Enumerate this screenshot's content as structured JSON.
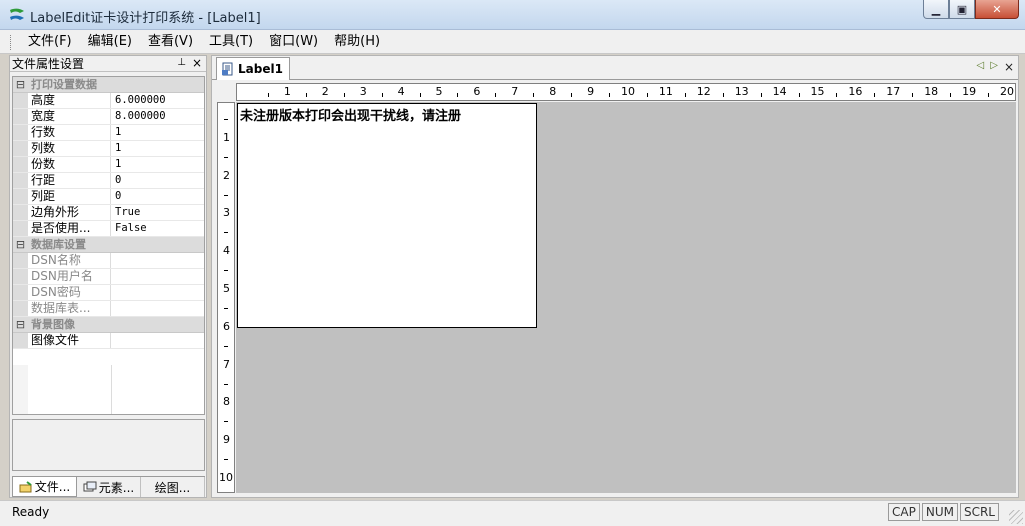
{
  "window": {
    "title": "LabelEdit证卡设计打印系统 - [Label1]",
    "minimize_glyph": "▁",
    "maximize_glyph": "▣",
    "close_glyph": "✕"
  },
  "menu": {
    "items": [
      "文件(F)",
      "编辑(E)",
      "查看(V)",
      "工具(T)",
      "窗口(W)",
      "帮助(H)"
    ]
  },
  "left_pane": {
    "title": "文件属性设置",
    "pin_glyph": "⊥",
    "close_glyph": "×",
    "categories": [
      {
        "name": "打印设置数据",
        "toggle": "⊟",
        "rows": [
          {
            "name": "高度",
            "value": "6.000000"
          },
          {
            "name": "宽度",
            "value": "8.000000"
          },
          {
            "name": "行数",
            "value": "1"
          },
          {
            "name": "列数",
            "value": "1"
          },
          {
            "name": "份数",
            "value": "1"
          },
          {
            "name": "行距",
            "value": "0"
          },
          {
            "name": "列距",
            "value": "0"
          },
          {
            "name": "边角外形",
            "value": "True"
          },
          {
            "name": "是否使用...",
            "value": "False"
          }
        ]
      },
      {
        "name": "数据库设置",
        "toggle": "⊟",
        "rows": [
          {
            "name": "DSN名称",
            "value": ""
          },
          {
            "name": "DSN用户名",
            "value": ""
          },
          {
            "name": "DSN密码",
            "value": ""
          },
          {
            "name": "数据库表...",
            "value": ""
          }
        ]
      },
      {
        "name": "背景图像",
        "toggle": "⊟",
        "rows": [
          {
            "name": "图像文件",
            "value": ""
          }
        ]
      }
    ],
    "tabs": [
      "文件...",
      "元素...",
      "绘图..."
    ]
  },
  "document": {
    "tab_label": "Label1",
    "nav_prev": "◁",
    "nav_next": "▷",
    "nav_close": "×",
    "ruler_top": [
      "1",
      "2",
      "3",
      "4",
      "5",
      "6",
      "7",
      "8",
      "9",
      "10",
      "11",
      "12",
      "13",
      "14",
      "15",
      "16",
      "17",
      "18",
      "19",
      "20"
    ],
    "ruler_left": [
      "1",
      "2",
      "3",
      "4",
      "5",
      "6",
      "7",
      "8",
      "9",
      "10"
    ],
    "watermark_text": "未注册版本打印会出现干扰线，请注册"
  },
  "statusbar": {
    "text": "Ready",
    "indicators": [
      "CAP",
      "NUM",
      "SCRL"
    ]
  },
  "colors": {
    "canvas": "#c0c0c0",
    "panel": "#f0f0f0",
    "close_button": "#c74f36"
  }
}
